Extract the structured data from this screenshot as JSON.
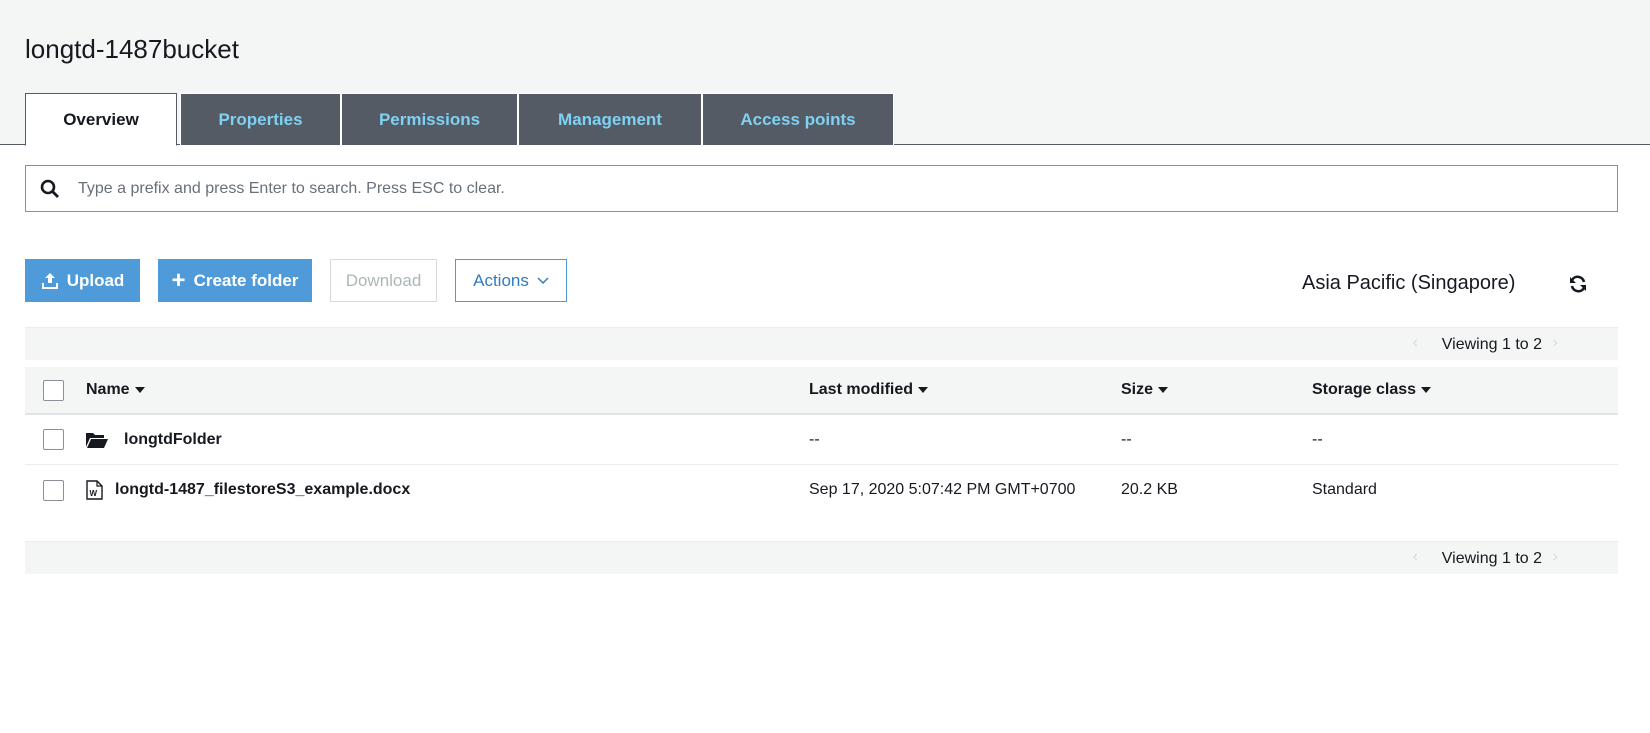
{
  "bucket_title": "longtd-1487bucket",
  "tabs": [
    {
      "label": "Overview"
    },
    {
      "label": "Properties"
    },
    {
      "label": "Permissions"
    },
    {
      "label": "Management"
    },
    {
      "label": "Access points"
    }
  ],
  "search": {
    "placeholder": "Type a prefix and press Enter to search. Press ESC to clear.",
    "value": ""
  },
  "toolbar": {
    "upload": "Upload",
    "create_folder": "Create folder",
    "download": "Download",
    "actions": "Actions"
  },
  "region": "Asia Pacific (Singapore)",
  "pagination": {
    "viewing": "Viewing 1 to 2"
  },
  "columns": {
    "name": "Name",
    "last_modified": "Last modified",
    "size": "Size",
    "storage_class": "Storage class"
  },
  "rows": [
    {
      "name": "longtdFolder",
      "type": "folder",
      "last_modified": "--",
      "size": "--",
      "storage_class": "--"
    },
    {
      "name": "longtd-1487_filestoreS3_example.docx",
      "type": "file",
      "last_modified": "Sep 17, 2020 5:07:42 PM GMT+0700",
      "size": "20.2 KB",
      "storage_class": "Standard"
    }
  ]
}
